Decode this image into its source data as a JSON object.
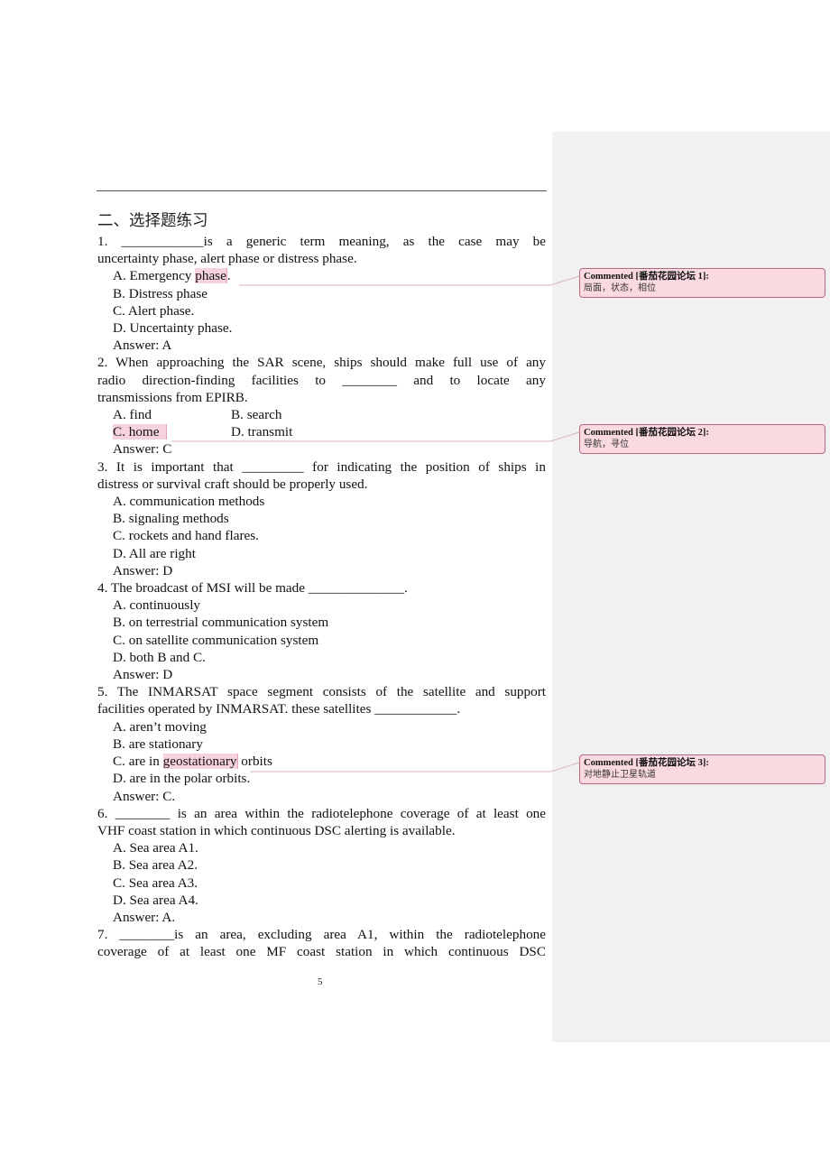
{
  "section_title": "二、选择题练习",
  "questions": [
    {
      "stem_line1": "1.  ____________is  a  generic  term  meaning,  as  the  case  may  be",
      "stem_line2": "uncertainty phase, alert phase or distress phase.",
      "options": {
        "a_prefix": "A. Emergency ",
        "a_highlight": "phase",
        "a_suffix": ".",
        "b": "B. Distress phase",
        "c": "C. Alert phase.",
        "d": "D. Uncertainty phase."
      },
      "answer": "Answer: A"
    },
    {
      "stem_line1": "2. When approaching the SAR scene, ships should make full use of any",
      "stem_line2": "radio  direction-finding  facilities  to  ________  and  to  locate  any",
      "stem_line3": "transmissions from EPIRB.",
      "options": {
        "a": "A. find",
        "b": "B. search",
        "c": "C. home",
        "d": "D. transmit"
      },
      "answer": "Answer: C"
    },
    {
      "stem_line1": "3. It is important that _________ for indicating the position of ships in",
      "stem_line2": "distress or survival craft should be properly used.",
      "options": {
        "a": "A. communication methods",
        "b": "B. signaling methods",
        "c": "C. rockets and hand flares.",
        "d": "D. All are right"
      },
      "answer": "Answer: D"
    },
    {
      "stem_line1": "4. The broadcast of MSI will be made ______________.",
      "options": {
        "a": "A. continuously",
        "b": "B. on terrestrial communication system",
        "c": "C. on satellite communication system",
        "d": "D. both B and C."
      },
      "answer": "Answer: D"
    },
    {
      "stem_line1": "5. The INMARSAT space segment consists of the satellite and support",
      "stem_line2": "facilities operated by INMARSAT. these satellites ____________.",
      "options": {
        "a": "A. aren’t moving",
        "b": "B. are stationary",
        "c_prefix": "C. are in ",
        "c_highlight": "geostationary",
        "c_suffix": " orbits",
        "d": "D. are in the polar orbits."
      },
      "answer": "Answer: C."
    },
    {
      "stem_line1": "6. ________ is an area within the radiotelephone coverage of at least one",
      "stem_line2": "VHF coast station in which continuous DSC alerting is available.",
      "options": {
        "a": "A. Sea area A1.",
        "b": "B. Sea area A2.",
        "c": "C. Sea area A3.",
        "d": "D. Sea area A4."
      },
      "answer": "Answer: A."
    },
    {
      "stem_line1": "7.  ________is  an  area,  excluding  area  A1,  within  the  radiotelephone",
      "stem_line2": "coverage  of  at  least  one  MF  coast  station  in  which  continuous  DSC"
    }
  ],
  "page_number": "5",
  "comments": [
    {
      "header": "Commented [番茄花园论坛 1]:",
      "body": "局面，状态，相位"
    },
    {
      "header": "Commented [番茄花园论坛 2]:",
      "body": "导航，寻位"
    },
    {
      "header": "Commented [番茄花园论坛 3]:",
      "body": "对地静止卫星轨道"
    }
  ],
  "colors": {
    "highlight": "#f6d2dc",
    "comment_bg": "#fbd9e1",
    "comment_border": "#b56a80",
    "pane_bg": "#f1f1f1"
  }
}
